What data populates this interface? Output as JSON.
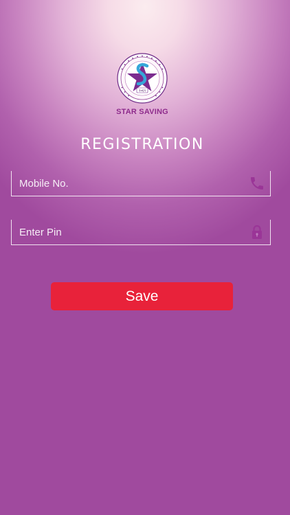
{
  "brand": {
    "name": "STAR SAVING",
    "logo_icon": "star-saving-logo-icon",
    "logo_year": "२०६९",
    "name_color": "#8e2b8c"
  },
  "screen": {
    "title": "REGISTRATION"
  },
  "form": {
    "mobile": {
      "placeholder": "Mobile No.",
      "value": "",
      "icon": "phone-icon"
    },
    "pin": {
      "placeholder": "Enter Pin",
      "value": "",
      "icon": "lock-icon"
    },
    "save_label": "Save"
  },
  "colors": {
    "background": "#a04a9e",
    "icon": "#9a3597",
    "button": "#e8223a"
  }
}
